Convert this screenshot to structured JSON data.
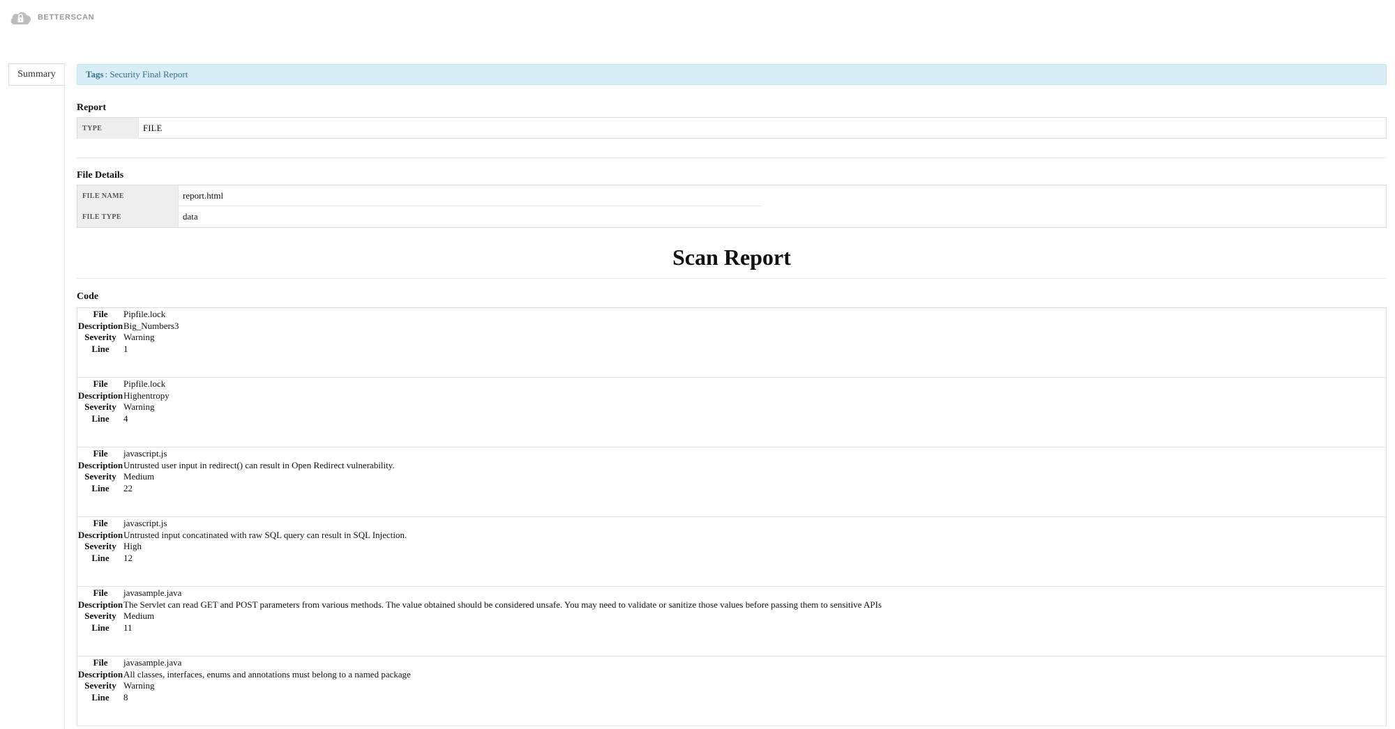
{
  "brand": {
    "name": "BETTERSCAN",
    "logo_icon": "cloud-lock-icon"
  },
  "tabs": [
    {
      "label": "Summary",
      "active": true
    }
  ],
  "tags": {
    "label": "Tags",
    "value": "Security Final Report"
  },
  "report": {
    "title": "Report",
    "rows": [
      {
        "key": "TYPE",
        "value": "FILE"
      }
    ]
  },
  "file_details": {
    "title": "File Details",
    "rows": [
      {
        "key": "FILE NAME",
        "value": "report.html"
      },
      {
        "key": "FILE TYPE",
        "value": "data"
      }
    ]
  },
  "scan_report": {
    "title": "Scan Report"
  },
  "code": {
    "title": "Code",
    "labels": {
      "file": "File",
      "description": "Description",
      "severity": "Severity",
      "line": "Line"
    },
    "findings": [
      {
        "file": "Pipfile.lock",
        "description": "Big_Numbers3",
        "severity": "Warning",
        "line": "1"
      },
      {
        "file": "Pipfile.lock",
        "description": "Highentropy",
        "severity": "Warning",
        "line": "4"
      },
      {
        "file": "javascript.js",
        "description": "Untrusted user input in redirect() can result in Open Redirect vulnerability.",
        "severity": "Medium",
        "line": "22"
      },
      {
        "file": "javascript.js",
        "description": "Untrusted input concatinated with raw SQL query can result in SQL Injection.",
        "severity": "High",
        "line": "12"
      },
      {
        "file": "javasample.java",
        "description": "The Servlet can read GET and POST parameters from various methods. The value obtained should be considered unsafe. You may need to validate or sanitize those values before passing them to sensitive APIs",
        "severity": "Medium",
        "line": "11"
      },
      {
        "file": "javasample.java",
        "description": "All classes, interfaces, enums and annotations must belong to a named package",
        "severity": "Warning",
        "line": "8"
      }
    ]
  },
  "colors": {
    "tags_bg": "#d9edf7",
    "tags_text": "#31708f",
    "key_bg": "#eeeeee"
  }
}
